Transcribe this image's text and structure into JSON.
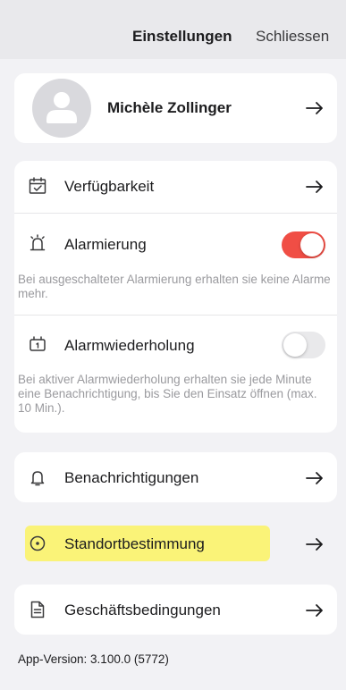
{
  "header": {
    "title": "Einstellungen",
    "close_label": "Schliessen"
  },
  "profile": {
    "name": "Michèle Zollinger"
  },
  "settings": {
    "availability_label": "Verfügbarkeit",
    "alarm": {
      "label": "Alarmierung",
      "enabled": true,
      "description": "Bei ausgeschalteter Alarmierung erhalten sie keine Alarme mehr."
    },
    "alarm_repeat": {
      "label": "Alarmwiederholung",
      "enabled": false,
      "description": "Bei aktiver Alarmwiederholung erhalten sie jede Minute eine Benachrichtigung, bis Sie den Einsatz öffnen (max. 10 Min.)."
    },
    "notifications_label": "Benachrichtigungen",
    "location_label": "Standortbestimmung",
    "terms_label": "Geschäftsbedingungen"
  },
  "footer": {
    "app_version": "App-Version: 3.100.0 (5772)"
  },
  "colors": {
    "toggle_on": "#f04e45",
    "toggle_off": "#e9e9eb",
    "highlight": "#fbf36a"
  },
  "icons": {
    "availability": "calendar-check-icon",
    "alarm": "alarm-bell-icon",
    "alarm_repeat": "calendar-repeat-icon",
    "notifications": "bell-icon",
    "location": "location-pin-icon",
    "terms": "document-icon",
    "arrow": "arrow-right-icon",
    "avatar": "user-avatar-icon"
  }
}
